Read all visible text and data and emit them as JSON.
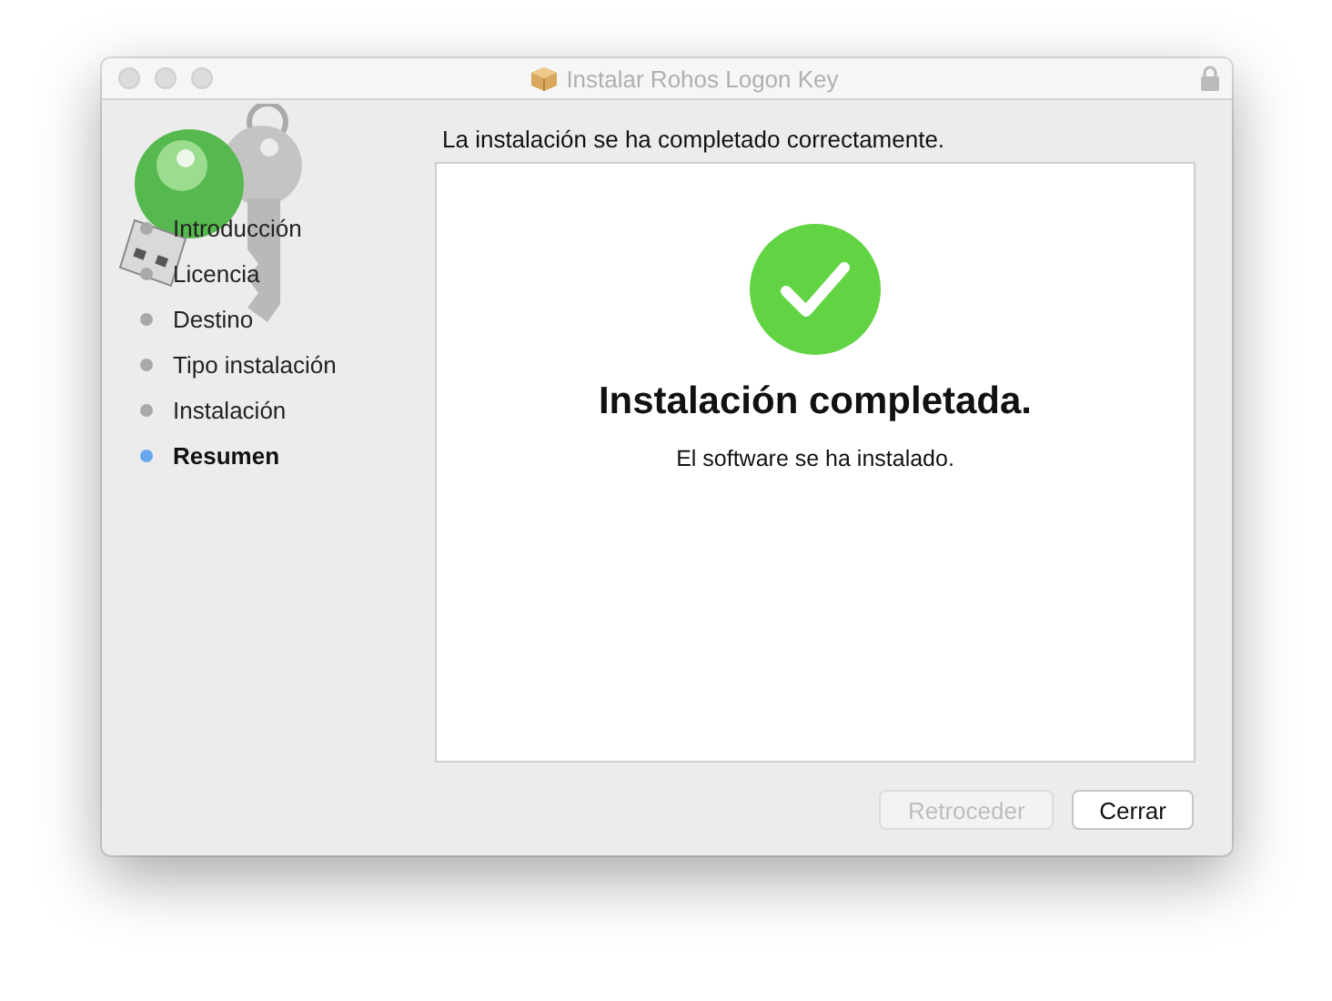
{
  "window": {
    "title": "Instalar Rohos Logon Key"
  },
  "header": "La instalación se ha completado correctamente.",
  "steps": [
    {
      "label": "Introducción",
      "selected": false
    },
    {
      "label": "Licencia",
      "selected": false
    },
    {
      "label": "Destino",
      "selected": false
    },
    {
      "label": "Tipo instalación",
      "selected": false
    },
    {
      "label": "Instalación",
      "selected": false
    },
    {
      "label": "Resumen",
      "selected": true
    }
  ],
  "panel": {
    "heading": "Instalación completada.",
    "message": "El software se ha instalado."
  },
  "buttons": [
    {
      "label": "Retroceder",
      "disabled": true
    },
    {
      "label": "Cerrar",
      "disabled": false
    }
  ]
}
